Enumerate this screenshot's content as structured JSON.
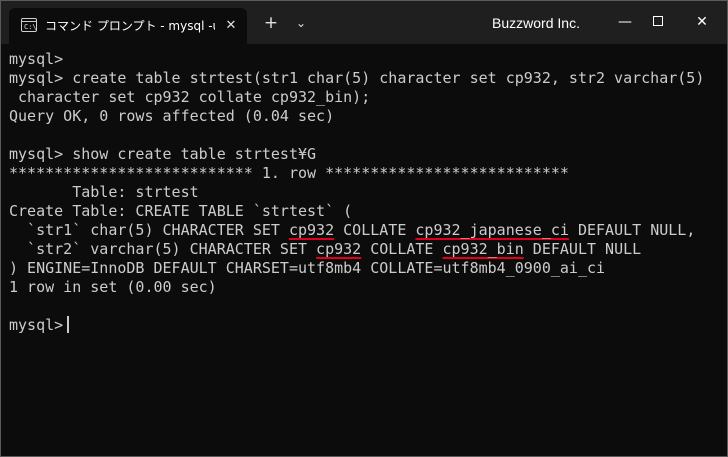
{
  "titlebar": {
    "tab_icon_label": "C:\\",
    "tab_title": "コマンド プロンプト - mysql  -u roc",
    "tab_close": "✕",
    "new_tab": "+",
    "tab_dropdown": "⌄",
    "brand": "Buzzword Inc.",
    "minimize": "—",
    "close": "✕"
  },
  "terminal": {
    "lines": [
      "mysql>",
      "mysql> create table strtest(str1 char(5) character set cp932, str2 varchar(5)",
      " character set cp932 collate cp932_bin);",
      "Query OK, 0 rows affected (0.04 sec)",
      "",
      "mysql> show create table strtest¥G",
      "*************************** 1. row ***************************",
      "       Table: strtest",
      "Create Table: CREATE TABLE `strtest` ("
    ],
    "line_str1": {
      "pre": "  `str1` char(5) CHARACTER SET ",
      "charset": "cp932",
      "mid": " COLLATE ",
      "collation": "cp932_japanese_ci",
      "post": " DEFAULT NULL,"
    },
    "line_str2": {
      "pre": "  `str2` varchar(5) CHARACTER SET ",
      "charset": "cp932",
      "mid": " COLLATE ",
      "collation": "cp932_bin",
      "post": " DEFAULT NULL"
    },
    "lines_after": [
      ") ENGINE=InnoDB DEFAULT CHARSET=utf8mb4 COLLATE=utf8mb4_0900_ai_ci",
      "1 row in set (0.00 sec)",
      "",
      "mysql>"
    ],
    "highlight_color": "#e0001b"
  }
}
